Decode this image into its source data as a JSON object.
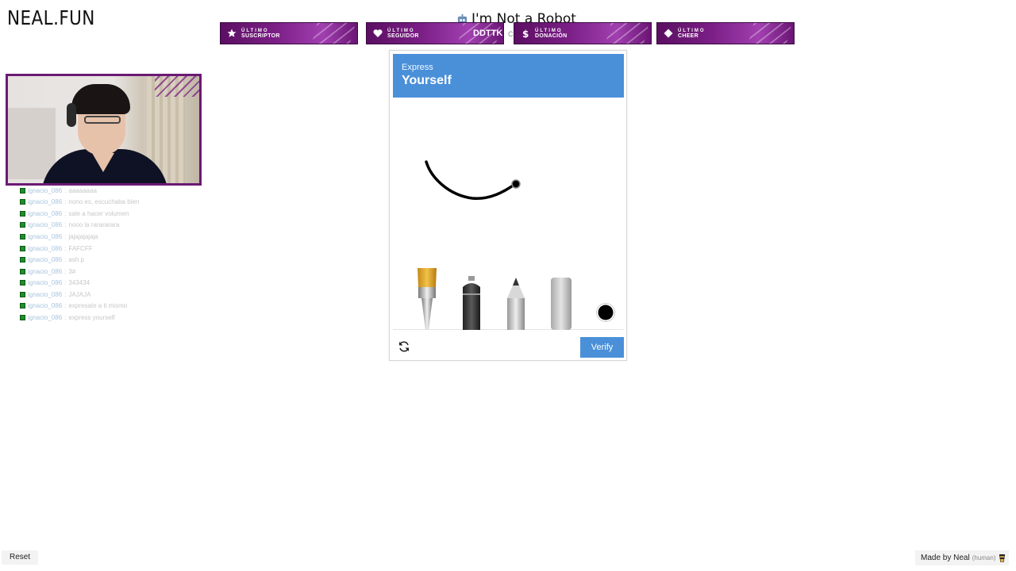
{
  "site": {
    "logo": "NEAL.FUN",
    "title": "I'm Not a Robot",
    "subtitle": "C"
  },
  "alerts": [
    {
      "small": "ÚLTIMO",
      "label": "SUSCRIPTOR",
      "value": "",
      "icon": "star-icon"
    },
    {
      "small": "ÚLTIMO",
      "label": "SEGUIDOR",
      "value": "DDTTK",
      "icon": "heart-icon"
    },
    {
      "small": "ÚLTIMO",
      "label": "DONACIÓN",
      "value": "",
      "icon": "dollar-icon"
    },
    {
      "small": "ÚLTIMO",
      "label": "CHEER",
      "value": "",
      "icon": "diamond-icon"
    }
  ],
  "chat": {
    "lines": [
      {
        "user": "ignacio_086",
        "msg": "aaaaaaaa"
      },
      {
        "user": "ignacio_086",
        "msg": "nono es, escuchaba bien"
      },
      {
        "user": "ignacio_086",
        "msg": "sale a hacer volumen"
      },
      {
        "user": "ignacio_086",
        "msg": "nooo la rarararara"
      },
      {
        "user": "ignacio_086",
        "msg": "jajajajajaja"
      },
      {
        "user": "ignacio_086",
        "msg": "FAFCFF"
      },
      {
        "user": "ignacio_086",
        "msg": "ash p"
      },
      {
        "user": "ignacio_086",
        "msg": "3#"
      },
      {
        "user": "ignacio_086",
        "msg": "343434"
      },
      {
        "user": "ignacio_086",
        "msg": "JAJAJA"
      },
      {
        "user": "ignacio_086",
        "msg": "expresate a ti mismo"
      },
      {
        "user": "ignacio_086",
        "msg": "express yourself"
      }
    ]
  },
  "captcha": {
    "header_small": "Express",
    "header_big": "Yourself",
    "tools": [
      "paintbrush-tool",
      "spray-can-tool",
      "pencil-tool",
      "eraser-tool",
      "color-picker"
    ],
    "selected_color": "#000000",
    "accent_color": "#4a90d9",
    "verify_label": "Verify"
  },
  "footer": {
    "reset_label": "Reset",
    "made_by": "Made by Neal",
    "human_label": "(human)"
  }
}
